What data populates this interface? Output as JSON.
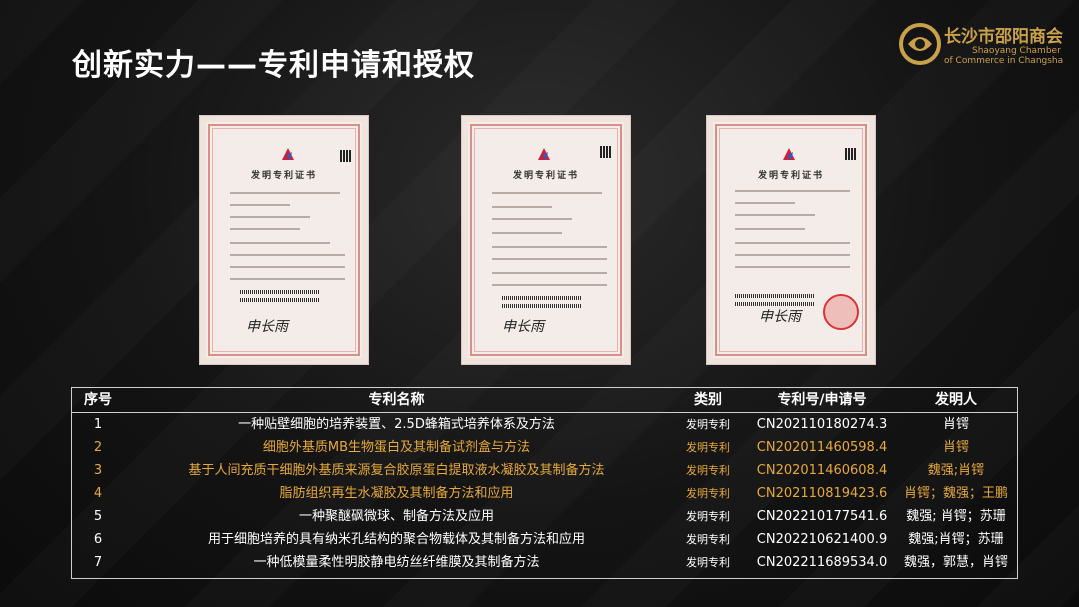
{
  "title": "创新实力——专利申请和授权",
  "logo": {
    "name_cn": "长沙市邵阳商会",
    "name_en_line1": "Shaoyang Chamber",
    "name_en_line2": "of Commerce in Changsha",
    "accent_color": "#c9a14a"
  },
  "certificate": {
    "heading": "发明专利证书",
    "signature": "申长雨"
  },
  "table": {
    "headers": [
      "序号",
      "专利名称",
      "类别",
      "专利号/申请号",
      "发明人"
    ],
    "rows": [
      {
        "num": "1",
        "name": "一种贴壁细胞的培养装置、2.5D蜂箱式培养体系及方法",
        "type": "发明专利",
        "no": "CN202110180274.3",
        "inventor": "肖锷",
        "highlight": false
      },
      {
        "num": "2",
        "name": "细胞外基质MB生物蛋白及其制备试剂盒与方法",
        "type": "发明专利",
        "no": "CN202011460598.4",
        "inventor": "肖锷",
        "highlight": true
      },
      {
        "num": "3",
        "name": "基于人间充质干细胞外基质来源复合胶原蛋白提取液水凝胶及其制备方法",
        "type": "发明专利",
        "no": "CN202011460608.4",
        "inventor": "魏强;肖锷",
        "highlight": true
      },
      {
        "num": "4",
        "name": "脂肪组织再生水凝胶及其制备方法和应用",
        "type": "发明专利",
        "no": "CN202110819423.6",
        "inventor": "肖锷；魏强；王鹏",
        "highlight": true
      },
      {
        "num": "5",
        "name": "一种聚醚砜微球、制备方法及应用",
        "type": "发明专利",
        "no": "CN202210177541.6",
        "inventor": "魏强; 肖锷；苏珊",
        "highlight": false
      },
      {
        "num": "6",
        "name": "用于细胞培养的具有纳米孔结构的聚合物载体及其制备方法和应用",
        "type": "发明专利",
        "no": "CN202210621400.9",
        "inventor": "魏强;肖锷；苏珊",
        "highlight": false
      },
      {
        "num": "7",
        "name": "一种低模量柔性明胶静电纺丝纤维膜及其制备方法",
        "type": "发明专利",
        "no": "CN202211689534.0",
        "inventor": "魏强，郭慧，肖锷",
        "highlight": false
      }
    ]
  },
  "colors": {
    "highlight": "#e7a93a",
    "normal": "#ffffff",
    "certificate_border": "#d98f86"
  }
}
